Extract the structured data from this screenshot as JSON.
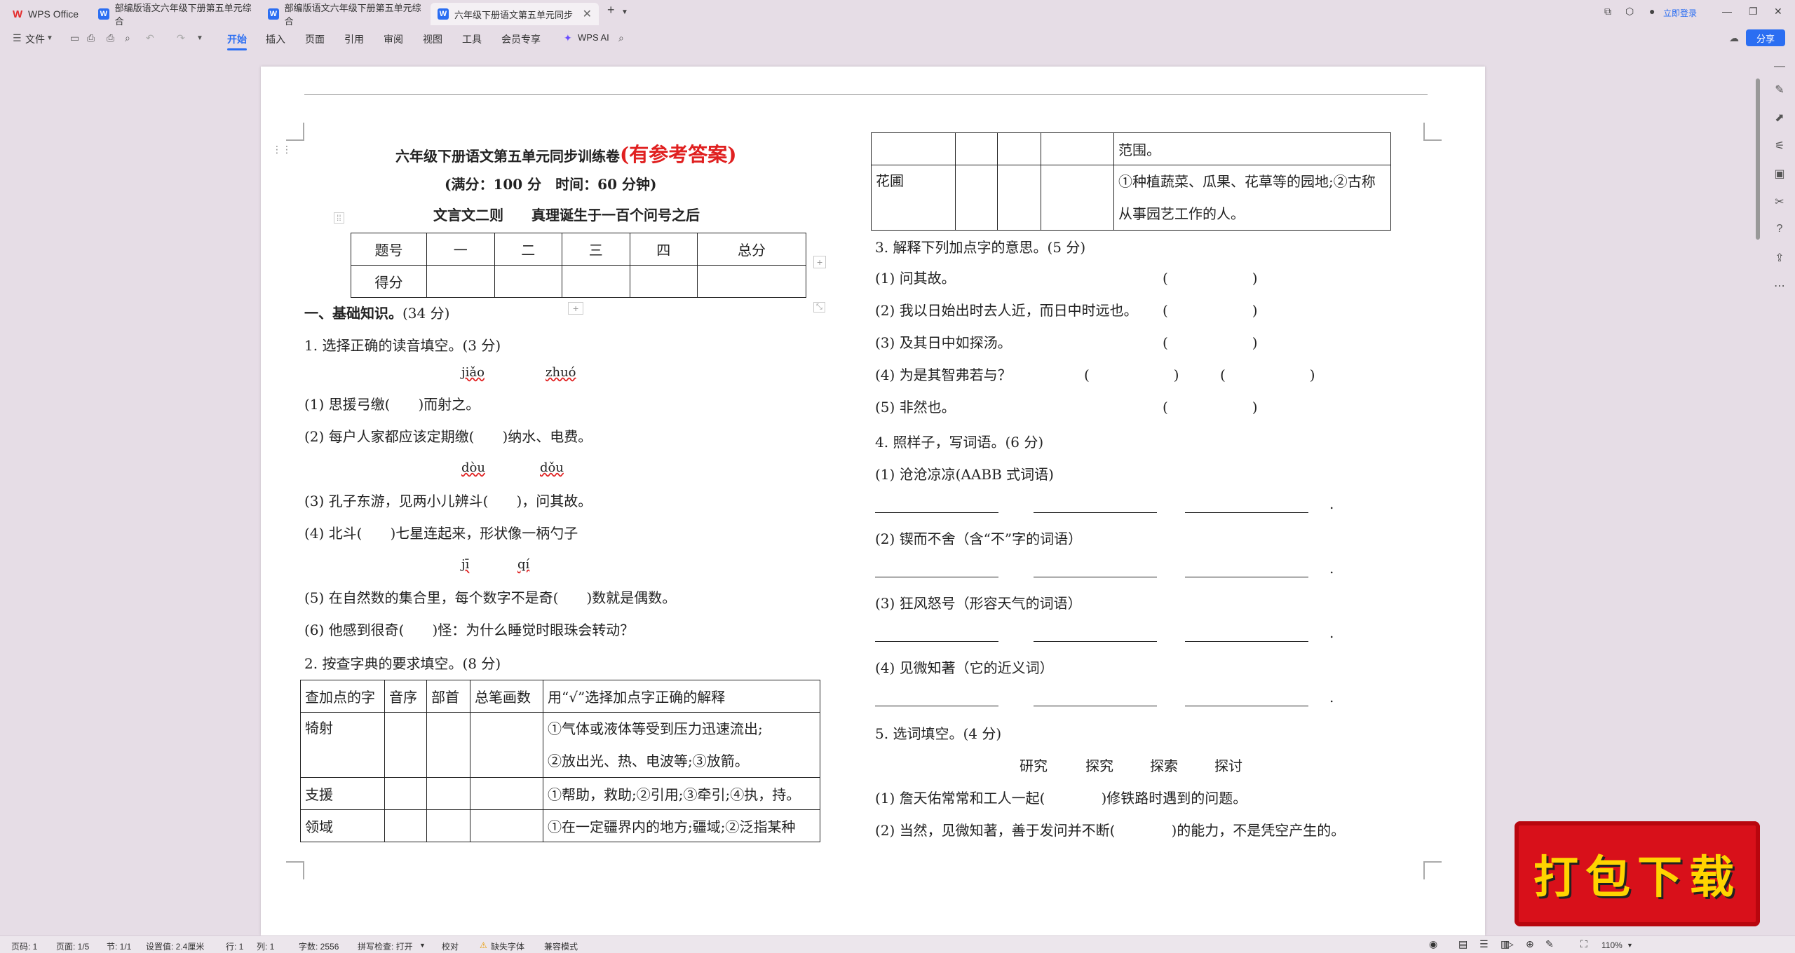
{
  "titlebar": {
    "tabs": [
      {
        "label": "WPS Office",
        "icon": "wps-logo-icon"
      },
      {
        "label": "部编版语文六年级下册第五单元综合",
        "icon": "word-doc-icon"
      },
      {
        "label": "部编版语文六年级下册第五单元综合",
        "icon": "word-doc-icon"
      },
      {
        "label": "六年级下册语文第五单元同步",
        "icon": "word-doc-icon"
      }
    ],
    "new_tab": "+",
    "login": "立即登录"
  },
  "menubar": {
    "file": "文件",
    "items": [
      "开始",
      "插入",
      "页面",
      "引用",
      "审阅",
      "视图",
      "工具",
      "会员专享"
    ],
    "active_index": 0,
    "wps_ai": "WPS AI",
    "share": "分享"
  },
  "doc": {
    "title_black": "六年级下册语文第五单元同步训练卷",
    "title_red": "(有参考答案)",
    "meta": "(满分：100 分　时间：60 分钟)",
    "subtitle": "文言文二则　　真理诞生于一百个问号之后",
    "score_table": {
      "header": [
        "题号",
        "一",
        "二",
        "三",
        "四",
        "总分"
      ],
      "row2_label": "得分"
    },
    "section1": "一、基础知识。",
    "section1_score": "(34 分)",
    "q1_title": "1. 选择正确的读音填空。(3 分)",
    "q1_pinyin_a": [
      "jiǎo",
      "zhuó"
    ],
    "q1_lines_a": [
      "(1) 思援弓缴(　　)而射之。",
      "(2) 每户人家都应该定期缴(　　)纳水、电费。"
    ],
    "q1_pinyin_b": [
      "dòu",
      "dǒu"
    ],
    "q1_lines_b": [
      "(3) 孔子东游，见两小儿辨斗(　　)，问其故。",
      "(4) 北斗(　　)七星连起来，形状像一柄勺子"
    ],
    "q1_pinyin_c": [
      "jī",
      "qí"
    ],
    "q1_lines_c": [
      "(5) 在自然数的集合里，每个数字不是奇(　　)数就是偶数。",
      "(6) 他感到很奇(　　)怪：为什么睡觉时眼珠会转动？"
    ],
    "q2_title": "2. 按查字典的要求填空。(8 分)",
    "dict_table": {
      "header": [
        "查加点的字",
        "音序",
        "部首",
        "总笔画数",
        "用“√”选择加点字正确的解释"
      ],
      "rows": [
        {
          "word": "犄射",
          "meaning": [
            "①气体或液体等受到压力迅速流出;",
            "②放出光、热、电波等;③放箭。"
          ]
        },
        {
          "word": "支援",
          "meaning": [
            "①帮助，救助;②引用;③牵引;④执，持。"
          ]
        },
        {
          "word": "领域",
          "meaning": [
            "①在一定疆界内的地方;疆域;②泛指某种"
          ]
        }
      ]
    },
    "right_table": {
      "rows": [
        {
          "word": "",
          "meaning": [
            "范围。"
          ]
        },
        {
          "word": "花圃",
          "meaning": [
            "①种植蔬菜、瓜果、花草等的园地;②古称",
            "从事园艺工作的人。"
          ]
        }
      ]
    },
    "q3_title": "3. 解释下列加点字的意思。(5 分)",
    "q3_lines": [
      {
        "text": "(1) 问其故。",
        "paren": "(　　　　　　)"
      },
      {
        "text": "(2) 我以日始出时去人近，而日中时远也。",
        "paren": "(　　　　　　)"
      },
      {
        "text": "(3) 及其日中如探汤。",
        "paren": "(　　　　　　)"
      },
      {
        "text": "(4) 为是其智弗若与？",
        "paren": "(　　　　　　)",
        "paren2": "(　　　　　　)"
      },
      {
        "text": "(5) 非然也。",
        "paren": "(　　　　　　)"
      }
    ],
    "q4_title": "4. 照样子，写词语。(6 分)",
    "q4_items": [
      "(1) 沧沧凉凉(AABB 式词语)",
      "(2) 锲而不舍（含“不”字的词语）",
      "(3) 狂风怒号（形容天气的词语）",
      "(4) 见微知著（它的近义词）"
    ],
    "q4_end": ".",
    "q5_title": "5. 选词填空。(4 分)",
    "q5_words": [
      "研究",
      "探究",
      "探索",
      "探讨"
    ],
    "q5_lines": [
      "(1) 詹天佑常常和工人一起(　　　　)修铁路时遇到的问题。",
      "(2) 当然，见微知著，善于发问并不断(　　　　)的能力，不是凭空产生的。"
    ]
  },
  "statusbar": {
    "page": "页码: 1",
    "pages": "页面: 1/5",
    "section": "节: 1/1",
    "setting": "设置值: 2.4厘米",
    "row": "行: 1",
    "col": "列: 1",
    "words": "字数: 2556",
    "spell": "拼写检查: 打开",
    "proof": "校对",
    "missing_font": "缺失字体",
    "compat": "兼容模式",
    "zoom": "110%"
  },
  "badge": {
    "text": "打包下载"
  },
  "colors": {
    "accent": "#2b6ef2",
    "title_red": "#e02020",
    "badge_red": "#d8101a",
    "badge_text": "#ffd400"
  }
}
